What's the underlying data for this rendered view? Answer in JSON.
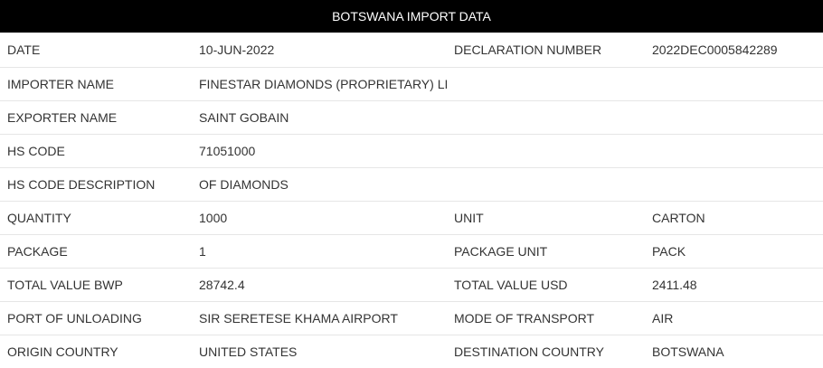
{
  "title": "BOTSWANA IMPORT DATA",
  "rows": [
    {
      "l1": "DATE",
      "v1": "10-JUN-2022",
      "l2": "DECLARATION NUMBER",
      "v2": "2022DEC0005842289"
    },
    {
      "l1": "IMPORTER NAME",
      "v1": "FINESTAR DIAMONDS (PROPRIETARY) LIMITED",
      "l2": "",
      "v2": ""
    },
    {
      "l1": "EXPORTER NAME",
      "v1": "SAINT GOBAIN",
      "l2": "",
      "v2": ""
    },
    {
      "l1": "HS CODE",
      "v1": "71051000",
      "l2": "",
      "v2": ""
    },
    {
      "l1": "HS CODE DESCRIPTION",
      "v1": "OF DIAMONDS",
      "l2": "",
      "v2": ""
    },
    {
      "l1": "QUANTITY",
      "v1": "1000",
      "l2": "UNIT",
      "v2": "CARTON"
    },
    {
      "l1": "PACKAGE",
      "v1": "1",
      "l2": "PACKAGE UNIT",
      "v2": "PACK"
    },
    {
      "l1": "TOTAL VALUE BWP",
      "v1": "28742.4",
      "l2": "TOTAL VALUE USD",
      "v2": "2411.48"
    },
    {
      "l1": "PORT OF UNLOADING",
      "v1": "SIR SERETESE KHAMA AIRPORT",
      "l2": "MODE OF TRANSPORT",
      "v2": "AIR"
    },
    {
      "l1": "ORIGIN COUNTRY",
      "v1": "UNITED STATES",
      "l2": "DESTINATION COUNTRY",
      "v2": "BOTSWANA"
    }
  ]
}
